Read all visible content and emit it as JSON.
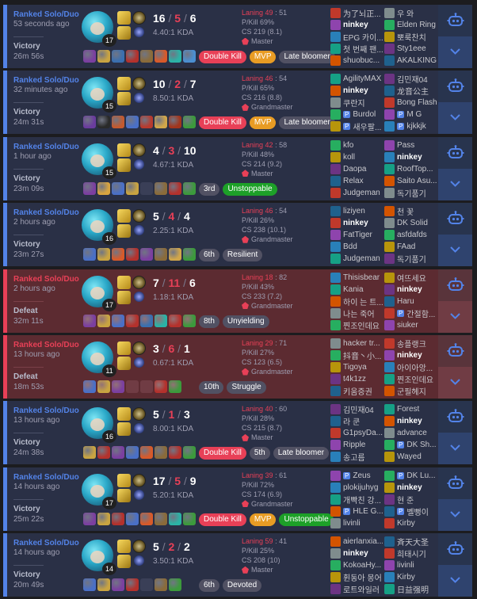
{
  "colors": {
    "win": "#5383e8",
    "loss": "#e84057",
    "mvp": "#e89c24",
    "green": "#1da028"
  },
  "icons": {
    "share": "share-robot-icon",
    "expand": "chevron-down-icon",
    "tier": "tier-emblem-icon"
  },
  "games": [
    {
      "mode": "Ranked Solo/Duo",
      "ago": "53 seconds ago",
      "result": "Victory",
      "duration": "26m 56s",
      "outcome": "win",
      "level": "17",
      "kills": "16",
      "deaths": "5",
      "assists": "6",
      "kda": "4.40:1 KDA",
      "laning_label": "Laning 49",
      "laning_opp": ": 51",
      "pkill": "P/Kill 69%",
      "cs": "CS 219 (8.1)",
      "tier": "Master",
      "items": [
        "#7b3fa0",
        "#c9a441",
        "#3a6fb0",
        "#b4312c",
        "#8a6b3a",
        "#d85a2a",
        "#2bb3a6",
        "#4b8fd1"
      ],
      "badges": [
        {
          "label": "Double Kill",
          "kind": "dk"
        },
        {
          "label": "MVP",
          "kind": "mvp"
        },
        {
          "label": "Late bloomer",
          "kind": "late"
        }
      ],
      "team1": [
        {
          "name": "为了뇌正..."
        },
        {
          "name": "ninkey",
          "me": true
        },
        {
          "name": "EPG 카이..."
        },
        {
          "name": "첫 번째 팬..."
        },
        {
          "name": "shuobuc..."
        }
      ],
      "team2": [
        {
          "name": "우 와"
        },
        {
          "name": "Elden Ring"
        },
        {
          "name": "뽀룩찬치"
        },
        {
          "name": "Sty1eee"
        },
        {
          "name": "AKALKING"
        }
      ]
    },
    {
      "mode": "Ranked Solo/Duo",
      "ago": "32 minutes ago",
      "result": "Victory",
      "duration": "24m 31s",
      "outcome": "win",
      "level": "15",
      "kills": "10",
      "deaths": "2",
      "assists": "7",
      "kda": "8.50:1 KDA",
      "laning_label": "Laning 46",
      "laning_opp": ": 54",
      "pkill": "P/Kill 65%",
      "cs": "CS 216 (8.8)",
      "tier": "Grandmaster",
      "items": [
        "#6a3c9e",
        "#2a2a2a",
        "#c35a2f",
        "#4a70c7",
        "#b83a2e",
        "#d1a64a",
        "#a2351c",
        "#3c9a3c"
      ],
      "badges": [
        {
          "label": "Double Kill",
          "kind": "dk"
        },
        {
          "label": "MVP",
          "kind": "mvp"
        },
        {
          "label": "Late bloomer",
          "kind": "late"
        }
      ],
      "team1": [
        {
          "name": "AgilityMAX"
        },
        {
          "name": "ninkey",
          "me": true
        },
        {
          "name": "쿠란지"
        },
        {
          "name": "Burdol",
          "p": true
        },
        {
          "name": "새우팔...",
          "p": true
        }
      ],
      "team2": [
        {
          "name": "김민재04"
        },
        {
          "name": "龙音公主"
        },
        {
          "name": "Bong Flash"
        },
        {
          "name": "M G",
          "p": true
        },
        {
          "name": "kjkkjk",
          "p": true
        }
      ]
    },
    {
      "mode": "Ranked Solo/Duo",
      "ago": "1 hour ago",
      "result": "Victory",
      "duration": "23m 09s",
      "outcome": "win",
      "level": "15",
      "kills": "4",
      "deaths": "3",
      "assists": "10",
      "kda": "4.67:1 KDA",
      "laning_label": "Laning 42",
      "laning_opp": ": 58",
      "pkill": "P/Kill 48%",
      "cs": "CS 214 (9.2)",
      "tier": "Master",
      "items": [
        "#7b3fa0",
        "#d8a440",
        "#4a70c7",
        "#c9a441",
        "",
        "#8a6b3a",
        "#b4312c",
        "#3c9a3c"
      ],
      "badges": [
        {
          "label": "3rd",
          "kind": "late"
        },
        {
          "label": "Unstoppable",
          "kind": "green"
        }
      ],
      "team1": [
        {
          "name": "kfo"
        },
        {
          "name": "koll"
        },
        {
          "name": "Daopa"
        },
        {
          "name": "Relax"
        },
        {
          "name": "Judgeman"
        }
      ],
      "team2": [
        {
          "name": "Pass"
        },
        {
          "name": "ninkey",
          "me": true
        },
        {
          "name": "RoofTop..."
        },
        {
          "name": "Saito Asu..."
        },
        {
          "name": "독기품기"
        }
      ]
    },
    {
      "mode": "Ranked Solo/Duo",
      "ago": "2 hours ago",
      "result": "Victory",
      "duration": "23m 27s",
      "outcome": "win",
      "level": "16",
      "kills": "5",
      "deaths": "4",
      "assists": "4",
      "kda": "2.25:1 KDA",
      "laning_label": "Laning 46",
      "laning_opp": ": 54",
      "pkill": "P/Kill 26%",
      "cs": "CS 238 (10.1)",
      "tier": "Grandmaster",
      "items": [
        "#4a70c7",
        "#c9a441",
        "#d85a2a",
        "#b4312c",
        "#7b3fa0",
        "#8a6b3a",
        "#d1a64a",
        "#3c9a3c"
      ],
      "badges": [
        {
          "label": "6th",
          "kind": "late"
        },
        {
          "label": "Resilient",
          "kind": "late"
        }
      ],
      "team1": [
        {
          "name": "liziyen"
        },
        {
          "name": "ninkey",
          "me": true
        },
        {
          "name": "FatTiger"
        },
        {
          "name": "Bdd"
        },
        {
          "name": "Judgeman"
        }
      ],
      "team2": [
        {
          "name": "천 꽃"
        },
        {
          "name": "DK Solid"
        },
        {
          "name": "asfdafds"
        },
        {
          "name": "FAad"
        },
        {
          "name": "독기품기"
        }
      ]
    },
    {
      "mode": "Ranked Solo/Duo",
      "ago": "2 hours ago",
      "result": "Defeat",
      "duration": "32m 11s",
      "outcome": "loss",
      "level": "17",
      "kills": "7",
      "deaths": "11",
      "assists": "6",
      "kda": "1.18:1 KDA",
      "laning_label": "Laning 18",
      "laning_opp": ": 82",
      "pkill": "P/Kill 43%",
      "cs": "CS 233 (7.2)",
      "tier": "Grandmaster",
      "items": [
        "#7b3fa0",
        "#c9a441",
        "#4a70c7",
        "#b4312c",
        "#3a6fb0",
        "#2bb3a6",
        "#b4312c",
        "#3c9a3c"
      ],
      "badges": [
        {
          "label": "8th",
          "kind": "late"
        },
        {
          "label": "Unyielding",
          "kind": "late"
        }
      ],
      "team1": [
        {
          "name": "Thisisbear"
        },
        {
          "name": "Kania"
        },
        {
          "name": "하이 는 트..."
        },
        {
          "name": "나는 죽어"
        },
        {
          "name": "찐조인데요"
        }
      ],
      "team2": [
        {
          "name": "여뜨세요"
        },
        {
          "name": "ninkey",
          "me": true
        },
        {
          "name": "Haru"
        },
        {
          "name": "간절함...",
          "p": true
        },
        {
          "name": "siuker"
        }
      ]
    },
    {
      "mode": "Ranked Solo/Duo",
      "ago": "13 hours ago",
      "result": "Defeat",
      "duration": "18m 53s",
      "outcome": "loss",
      "level": "11",
      "kills": "3",
      "deaths": "6",
      "assists": "1",
      "kda": "0.67:1 KDA",
      "laning_label": "Laning 29",
      "laning_opp": ": 71",
      "pkill": "P/Kill 27%",
      "cs": "CS 123 (6.5)",
      "tier": "Grandmaster",
      "items": [
        "#4a70c7",
        "#c9a441",
        "#7b3fa0",
        "",
        "",
        "#b4312c",
        "#3c9a3c"
      ],
      "badges": [
        {
          "label": "10th",
          "kind": "late"
        },
        {
          "label": "Struggle",
          "kind": "late"
        }
      ],
      "team1": [
        {
          "name": "hacker tr..."
        },
        {
          "name": "抖音丶小..."
        },
        {
          "name": "Tigoya"
        },
        {
          "name": "t4k1zz"
        },
        {
          "name": "키움증권"
        }
      ],
      "team2": [
        {
          "name": "송플랭크"
        },
        {
          "name": "ninkey",
          "me": true
        },
        {
          "name": "아이아앙..."
        },
        {
          "name": "찐조인데요"
        },
        {
          "name": "군필헤지"
        }
      ]
    },
    {
      "mode": "Ranked Solo/Duo",
      "ago": "13 hours ago",
      "result": "Victory",
      "duration": "24m 38s",
      "outcome": "win",
      "level": "16",
      "kills": "5",
      "deaths": "1",
      "assists": "3",
      "kda": "8.00:1 KDA",
      "laning_label": "Laning 40",
      "laning_opp": ": 60",
      "pkill": "P/Kill 28%",
      "cs": "CS 215 (8.7)",
      "tier": "Master",
      "items": [
        "#c9a441",
        "#b4312c",
        "#7b3fa0",
        "#4a70c7",
        "#d85a2a",
        "#8a6b3a",
        "#b4312c",
        "#3c9a3c"
      ],
      "badges": [
        {
          "label": "Double Kill",
          "kind": "dk"
        },
        {
          "label": "5th",
          "kind": "late"
        },
        {
          "label": "Late bloomer",
          "kind": "late"
        }
      ],
      "team1": [
        {
          "name": "김민재04"
        },
        {
          "name": "라 쿤"
        },
        {
          "name": "G1psyDa..."
        },
        {
          "name": "Ripple"
        },
        {
          "name": "송고름"
        }
      ],
      "team2": [
        {
          "name": "Forest"
        },
        {
          "name": "ninkey",
          "me": true
        },
        {
          "name": "advance"
        },
        {
          "name": "DK Sh...",
          "p": true
        },
        {
          "name": "Wayed"
        }
      ]
    },
    {
      "mode": "Ranked Solo/Duo",
      "ago": "14 hours ago",
      "result": "Victory",
      "duration": "25m 22s",
      "outcome": "win",
      "level": "17",
      "kills": "17",
      "deaths": "5",
      "assists": "9",
      "kda": "5.20:1 KDA",
      "laning_label": "Laning 39",
      "laning_opp": ": 61",
      "pkill": "P/Kill 72%",
      "cs": "CS 174 (6.9)",
      "tier": "Grandmaster",
      "items": [
        "#7b3fa0",
        "#c9a441",
        "#b4312c",
        "#4a70c7",
        "#d85a2a",
        "#8a6b3a",
        "#2bb3a6",
        "#3c9a3c"
      ],
      "badges": [
        {
          "label": "Double Kill",
          "kind": "dk"
        },
        {
          "label": "MVP",
          "kind": "mvp"
        },
        {
          "label": "Unstoppable",
          "kind": "green"
        }
      ],
      "team1": [
        {
          "name": "Zeus",
          "p": true
        },
        {
          "name": "plokijuhyg"
        },
        {
          "name": "개빡친 강..."
        },
        {
          "name": "HLE G...",
          "p": true
        },
        {
          "name": "livinli"
        }
      ],
      "team2": [
        {
          "name": "DK Lu...",
          "p": true
        },
        {
          "name": "ninkey",
          "me": true
        },
        {
          "name": "현 준"
        },
        {
          "name": "벨뻥이",
          "p": true
        },
        {
          "name": "Kirby"
        }
      ]
    },
    {
      "mode": "Ranked Solo/Duo",
      "ago": "14 hours ago",
      "result": "Victory",
      "duration": "20m 49s",
      "outcome": "win",
      "level": "14",
      "kills": "5",
      "deaths": "2",
      "assists": "2",
      "kda": "3.50:1 KDA",
      "laning_label": "Laning 59",
      "laning_opp": ": 41",
      "pkill": "P/Kill 25%",
      "cs": "CS 208 (10)",
      "tier": "Master",
      "items": [
        "#4a70c7",
        "#c9a441",
        "#7b3fa0",
        "#b4312c",
        "",
        "#8a6b3a",
        "#3c9a3c"
      ],
      "badges": [
        {
          "label": "6th",
          "kind": "late"
        },
        {
          "label": "Devoted",
          "kind": "late"
        }
      ],
      "team1": [
        {
          "name": "aierlanxia..."
        },
        {
          "name": "ninkey",
          "me": true
        },
        {
          "name": "KokoaHy..."
        },
        {
          "name": "휜동아 몽어"
        },
        {
          "name": "로트와일러"
        }
      ],
      "team2": [
        {
          "name": "斉天大圣"
        },
        {
          "name": "희태시기"
        },
        {
          "name": "livinli"
        },
        {
          "name": "Kirby"
        },
        {
          "name": "日益强明"
        }
      ]
    }
  ]
}
